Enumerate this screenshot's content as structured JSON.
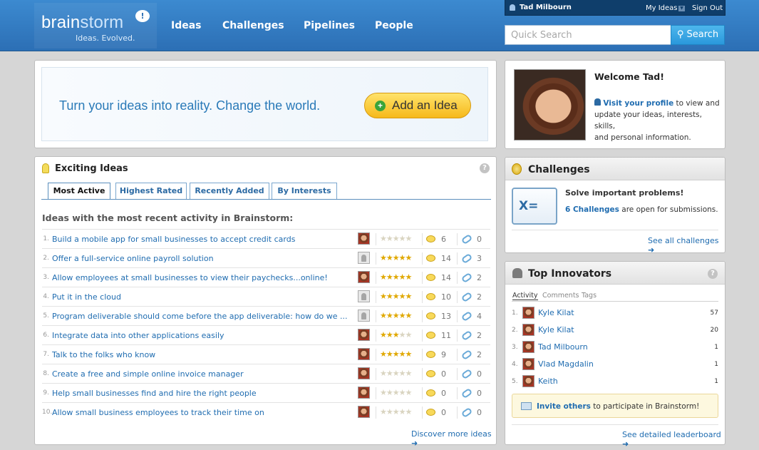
{
  "header": {
    "logo_brain": "brain",
    "logo_storm": "storm",
    "logo_bubble": "!",
    "tagline": "Ideas. Evolved.",
    "nav": [
      "Ideas",
      "Challenges",
      "Pipelines",
      "People"
    ],
    "user": {
      "name": "Tad Milbourn",
      "my_ideas": "My Ideas",
      "sign_out": "Sign Out"
    },
    "search": {
      "placeholder": "Quick Search",
      "button": "Search"
    }
  },
  "hero": {
    "text": "Turn your ideas into reality.  Change the world.",
    "button": "Add an Idea"
  },
  "ideas": {
    "title": "Exciting Ideas",
    "help": "?",
    "tabs": [
      "Most Active",
      "Highest Rated",
      "Recently Added",
      "By Interests"
    ],
    "subheading": "Ideas with the most recent activity in Brainstorm:",
    "rows": [
      {
        "num": "1.",
        "title": "Build a mobile app for small businesses to accept credit cards",
        "avatar": "photo",
        "stars": 0,
        "comments": "6",
        "links": "0"
      },
      {
        "num": "2.",
        "title": "Offer a full-service online payroll solution",
        "avatar": "blank",
        "stars": 5,
        "comments": "14",
        "links": "3"
      },
      {
        "num": "3.",
        "title": "Allow employees at small businesses to view their paychecks...online!",
        "avatar": "photo",
        "stars": 5,
        "comments": "14",
        "links": "2"
      },
      {
        "num": "4.",
        "title": "Put it in the cloud",
        "avatar": "blank",
        "stars": 5,
        "comments": "10",
        "links": "2"
      },
      {
        "num": "5.",
        "title": "Program deliverable should come before the app deliverable: how do we ...",
        "avatar": "blank",
        "stars": 5,
        "comments": "13",
        "links": "4"
      },
      {
        "num": "6.",
        "title": "Integrate data into other applications easily",
        "avatar": "photo",
        "stars": 3,
        "comments": "11",
        "links": "2"
      },
      {
        "num": "7.",
        "title": "Talk to the folks who know",
        "avatar": "photo",
        "stars": 5,
        "comments": "9",
        "links": "2"
      },
      {
        "num": "8.",
        "title": "Create a free and simple online invoice manager",
        "avatar": "photo",
        "stars": 0,
        "comments": "0",
        "links": "0"
      },
      {
        "num": "9.",
        "title": "Help small businesses find and hire the right people",
        "avatar": "photo",
        "stars": 0,
        "comments": "0",
        "links": "0"
      },
      {
        "num": "10.",
        "title": "Allow small business employees to track their time on",
        "avatar": "photo",
        "stars": 0,
        "comments": "0",
        "links": "0"
      }
    ],
    "discover": "Discover more ideas"
  },
  "welcome": {
    "title": "Welcome Tad!",
    "profile_link": "Visit your profile",
    "text1": " to view and",
    "text2": "update your ideas, interests, skills,",
    "text3": "and personal information."
  },
  "challenges": {
    "title": "Challenges",
    "icon_text": "X=",
    "heading": "Solve important problems!",
    "count_link": "6 Challenges",
    "count_text": " are open for submissions.",
    "see_all": "See all challenges"
  },
  "innovators": {
    "title": "Top Innovators",
    "help": "?",
    "tabs": [
      "Activity",
      "Comments",
      "Tags"
    ],
    "rows": [
      {
        "num": "1.",
        "name": "Kyle Kilat",
        "count": "57"
      },
      {
        "num": "2.",
        "name": "Kyle Kilat",
        "count": "20"
      },
      {
        "num": "3.",
        "name": "Tad Milbourn",
        "count": "1"
      },
      {
        "num": "4.",
        "name": "Vlad Magdalin",
        "count": "1"
      },
      {
        "num": "5.",
        "name": "Keith",
        "count": "1"
      }
    ],
    "invite_link": "Invite others",
    "invite_text": " to participate in Brainstorm!",
    "leaderboard": "See detailed leaderboard"
  },
  "colors": {
    "header_blue": "#2c6fb5",
    "link_blue": "#1f6cb0",
    "button_yellow": "#f6b91a",
    "search_blue": "#2a98dc"
  }
}
